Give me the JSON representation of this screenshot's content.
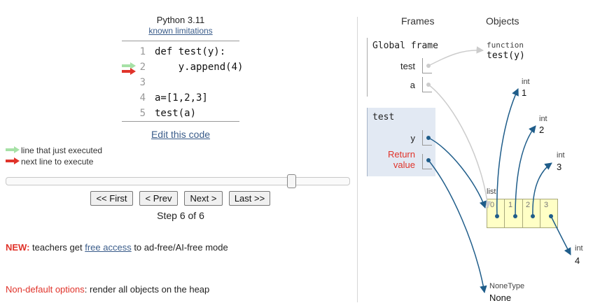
{
  "header": {
    "language": "Python 3.11",
    "limitations_link": "known limitations"
  },
  "code": {
    "lines": [
      {
        "num": "1",
        "text": "def test(y):"
      },
      {
        "num": "2",
        "text": "    y.append(4)"
      },
      {
        "num": "3",
        "text": ""
      },
      {
        "num": "4",
        "text": "a=[1,2,3]"
      },
      {
        "num": "5",
        "text": "test(a)"
      }
    ],
    "current_line": "2"
  },
  "edit_link": "Edit this code",
  "legend": {
    "executed": "line that just executed",
    "next": "next line to execute"
  },
  "colors": {
    "executed_arrow": "#a6e1a6",
    "next_arrow": "#e0332a",
    "frame_highlight": "#e2e9f3",
    "list_bg": "#ffffc6",
    "pointer": "#1f5d8a"
  },
  "slider": {
    "step": 6,
    "total": 6
  },
  "nav": {
    "first": "<< First",
    "prev": "< Prev",
    "next": "Next >",
    "last": "Last >>"
  },
  "step_text": "Step 6 of 6",
  "notice": {
    "prefix": "NEW:",
    "before": " teachers get ",
    "link": "free access",
    "after": " to ad-free/AI-free mode"
  },
  "options": {
    "label": "Non-default options",
    "text": ": render all objects on the heap"
  },
  "viz": {
    "frames_header": "Frames",
    "objects_header": "Objects",
    "global_frame": {
      "title": "Global frame",
      "vars": [
        "test",
        "a"
      ]
    },
    "test_frame": {
      "title": "test",
      "var": "y",
      "return_label_1": "Return",
      "return_label_2": "value"
    },
    "function_obj": {
      "type": "function",
      "value": "test(y)"
    },
    "ints": [
      {
        "type": "int",
        "value": "1"
      },
      {
        "type": "int",
        "value": "2"
      },
      {
        "type": "int",
        "value": "3"
      },
      {
        "type": "int",
        "value": "4"
      }
    ],
    "list_obj": {
      "type": "list",
      "indices": [
        "0",
        "1",
        "2",
        "3"
      ]
    },
    "none_obj": {
      "type": "NoneType",
      "value": "None"
    }
  }
}
